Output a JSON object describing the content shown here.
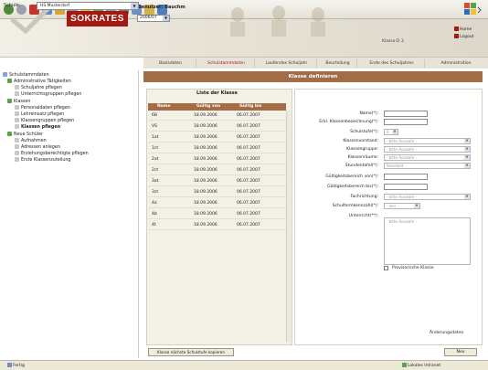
{
  "header": {
    "brand": "SOKRATES",
    "user_label": "Benutzer: Bauchm",
    "year_value": "2006/07",
    "class_info": "Klasse:D 3",
    "home_label": "Home",
    "logout_label": "Logout"
  },
  "school": {
    "label": "Schule:",
    "value": "HS Musterdorf"
  },
  "tabs": [
    "Basisdaten",
    "Schulstammdaten",
    "Laufendes Schuljahr",
    "Beurteilung",
    "Ende des Schuljahres",
    "Administration"
  ],
  "sidebar": {
    "items": [
      {
        "label": "Schulstammdaten",
        "level": 0,
        "bold": false
      },
      {
        "label": "Administrative Tätigkeiten",
        "level": 1,
        "bold": false
      },
      {
        "label": "Schuljahre pflegen",
        "level": 2,
        "bold": false
      },
      {
        "label": "Unterrichtsgruppen pflegen",
        "level": 2,
        "bold": false
      },
      {
        "label": "Klassen",
        "level": 1,
        "bold": false
      },
      {
        "label": "Personaldaten pflegen",
        "level": 2,
        "bold": false
      },
      {
        "label": "Lehreinsatz pflegen",
        "level": 2,
        "bold": false
      },
      {
        "label": "Klassengruppen pflegen",
        "level": 2,
        "bold": false
      },
      {
        "label": "Klassen pflegen",
        "level": 2,
        "bold": true
      },
      {
        "label": "Neue Schüler",
        "level": 1,
        "bold": false
      },
      {
        "label": "Aufnahmen",
        "level": 2,
        "bold": false
      },
      {
        "label": "Adressen anlegen",
        "level": 2,
        "bold": false
      },
      {
        "label": "Erziehungsberechtigte pflegen",
        "level": 2,
        "bold": false
      },
      {
        "label": "Erste Klassenzuteilung",
        "level": 2,
        "bold": false
      }
    ]
  },
  "content": {
    "title": "Klasse definieren",
    "list_title": "Liste der Klasse",
    "columns": [
      "Name",
      "Gültig von",
      "Gültig bis"
    ],
    "rows": [
      [
        "6B",
        "18.09.2006",
        "06.07.2007"
      ],
      [
        "VS",
        "18.09.2006",
        "06.07.2007"
      ],
      [
        "1at",
        "18.09.2006",
        "06.07.2007"
      ],
      [
        "1ct",
        "18.09.2006",
        "06.07.2007"
      ],
      [
        "2at",
        "18.09.2006",
        "06.07.2007"
      ],
      [
        "2ct",
        "18.09.2006",
        "06.07.2007"
      ],
      [
        "3at",
        "18.09.2006",
        "06.07.2007"
      ],
      [
        "3ct",
        "18.09.2006",
        "06.07.2007"
      ],
      [
        "4a",
        "18.09.2006",
        "06.07.2007"
      ],
      [
        "4b",
        "18.09.2006",
        "06.07.2007"
      ],
      [
        "4t",
        "18.09.2006",
        "06.07.2007"
      ]
    ],
    "copy_button": "Klasse nächste Schulstufe kopieren",
    "new_button": "Neu",
    "changes_link": "Änderungsdaten"
  },
  "form": {
    "name_label": "Name(*):",
    "long_name_label": "Erkl. Klassenbezeichnung(*):",
    "level_label": "Schulstufe(*):",
    "level_value": "0",
    "teacher_label": "Klassenvorstand:",
    "group_label": "Klassengruppe:",
    "room_label": "Klassenräume:",
    "status_label": "Stundentafel(*):",
    "status_value": "Standard",
    "valid_from_label": "Gültigkeitsbereich von(*):",
    "valid_to_label": "Gültigkeitsbereich bis(*):",
    "subject_label": "Fachrichtung:",
    "school_form_label": "Schulformkennzahl(*):",
    "unterricht_label": "Unterricht(**):",
    "select_placeholder": "- bitte Auswahl -",
    "select_none": "- leer -",
    "checkbox_label": "Provisorische Klasse"
  },
  "status": {
    "text": "Fertig",
    "zone": "Lokales Intranet"
  },
  "colors": {
    "brand_red": "#a31a12",
    "header_brown": "#a16c46",
    "panel_bg": "#f3f0e6"
  }
}
